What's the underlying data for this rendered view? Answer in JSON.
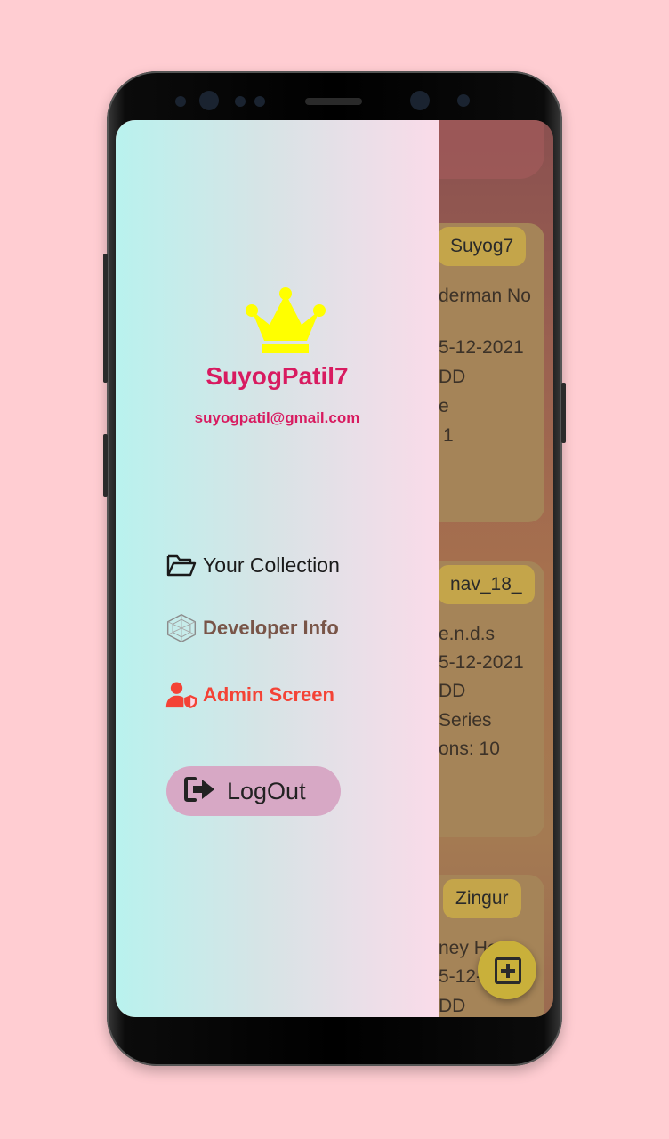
{
  "drawer": {
    "user_name": "SuyogPatil7",
    "user_email": "suyogpatil@gmail.com",
    "menu": [
      {
        "label": "Your Collection",
        "icon": "folder-open-icon"
      },
      {
        "label": "Developer Info",
        "icon": "hexagon-network-icon"
      },
      {
        "label": "Admin Screen",
        "icon": "admin-shield-icon"
      }
    ],
    "logout_label": "LogOut"
  },
  "background_list": {
    "cards": [
      {
        "tag": "Suyog7",
        "lines": [
          "derman No",
          "5-12-2021",
          "DD",
          "e",
          "1"
        ]
      },
      {
        "tag": "nav_18_",
        "lines": [
          "e.n.d.s",
          "5-12-2021",
          "DD",
          "Series",
          "ons: 10"
        ]
      },
      {
        "tag": "Zingur",
        "lines": [
          "ney He",
          "5-12-...",
          "DD"
        ]
      }
    ]
  },
  "colors": {
    "accent": "#d81b60",
    "crown": "#ffff00",
    "developer_label": "#795548",
    "admin_label": "#f44336",
    "logout_button": "#d7a8c5"
  }
}
